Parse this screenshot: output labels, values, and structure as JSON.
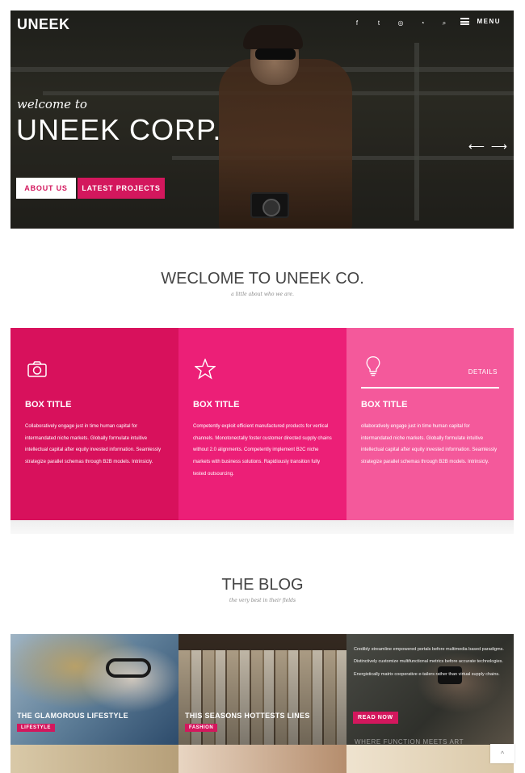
{
  "header": {
    "logo": "UNEEK",
    "social_icons": [
      {
        "name": "facebook-icon",
        "glyph": "f"
      },
      {
        "name": "twitter-icon",
        "glyph": "t"
      },
      {
        "name": "dribbble-icon",
        "glyph": "◎"
      },
      {
        "name": "rss-icon",
        "glyph": "◔"
      },
      {
        "name": "search-icon",
        "glyph": "⌕"
      }
    ],
    "menu_label": "MENU"
  },
  "hero": {
    "welcome": "welcome to",
    "title": "UNEEK CORP.",
    "about_button": "ABOUT US",
    "latest_button": "LATEST PROJECTS",
    "prev_arrow": "⟵",
    "next_arrow": "⟶"
  },
  "welcome_section": {
    "title": "WECLOME TO UNEEK CO.",
    "subtitle": "a little about who we are."
  },
  "boxes": [
    {
      "icon": "camera-icon",
      "title": "BOX TITLE",
      "text": "Collaboratively engage just in time human capital for intermandated niche markets. Globally formulate intuitive intellectual capital after equity invested information. Seamlessly strategize parallel schemas through B2B models. Intrinsicly.",
      "color": "#d8115c"
    },
    {
      "icon": "star-icon",
      "title": "BOX TITLE",
      "text": "Competently exploit efficient manufactured products for vertical channels. Monotonectally foster customer directed supply chains without 2.0 alignments. Competently implement B2C niche markets with business solutions. Rapidiously transition fully tested outsourcing.",
      "color": "#ec1f77"
    },
    {
      "icon": "lightbulb-icon",
      "title": "BOX TITLE",
      "details": "DETAILS",
      "text": "ollaboratively engage just in time human capital for intermandated niche markets. Globally formulate intuitive intellectual capital after equity invested information. Seamlessly strategize parallel schemas through B2B models. Intrinsicly.",
      "color": "#f4599b"
    }
  ],
  "blog_section": {
    "title": "THE BLOG",
    "subtitle": "the very best in their fields"
  },
  "posts": [
    {
      "title": "THE GLAMOROUS LIFESTYLE",
      "tag": "LIFESTYLE"
    },
    {
      "title": "THIS SEASONS HOTTESTS LINES",
      "tag": "FASHION"
    },
    {
      "text": "Credibly streamline empowered portals before multimedia based paradigms. Distinctively customize multifunctional metrics before accurate technologies. Energistically matrix cooperative e-tailers rather than virtual supply chains.",
      "read_more": "READ NOW",
      "faded_title": "WHERE FUNCTION MEETS ART"
    }
  ],
  "back_to_top": "^"
}
